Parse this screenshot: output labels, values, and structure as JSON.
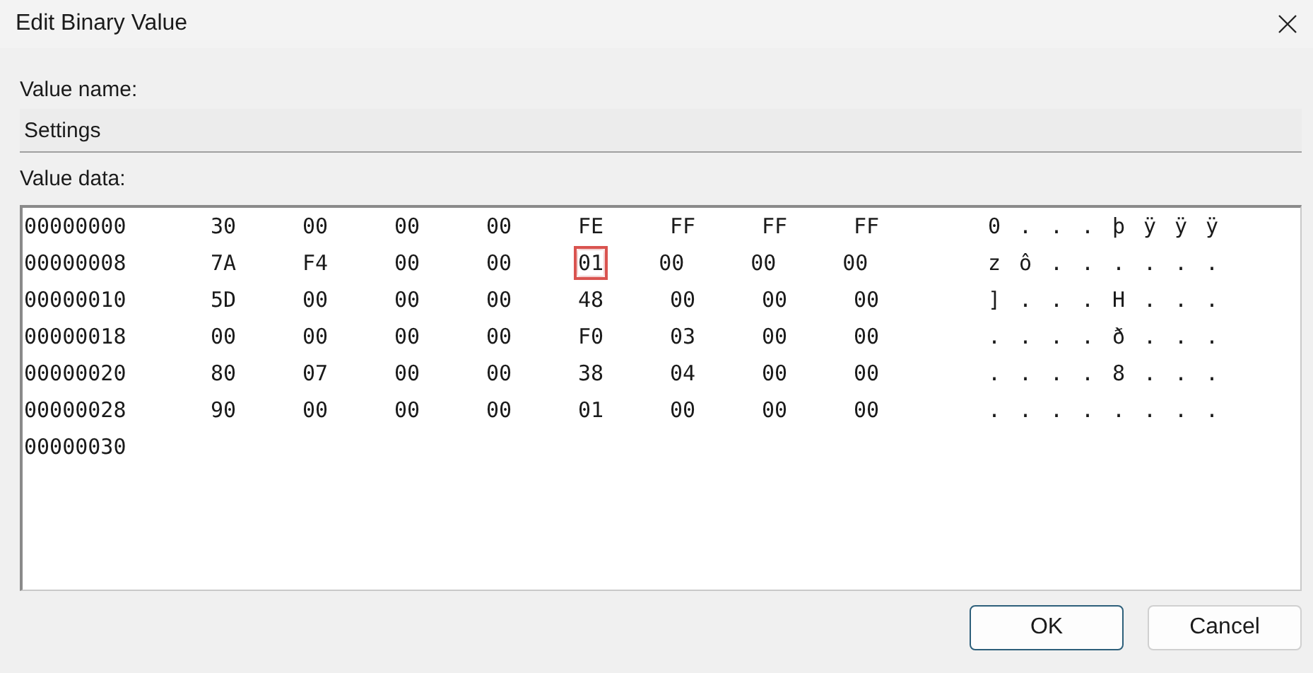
{
  "window": {
    "title": "Edit Binary Value"
  },
  "value_name": {
    "label": "Value name:",
    "value": "Settings"
  },
  "value_data": {
    "label": "Value data:",
    "rows": [
      {
        "address": "00000000",
        "bytes": [
          {
            "text": "30",
            "highlighted": false
          },
          {
            "text": "00",
            "highlighted": false
          },
          {
            "text": "00",
            "highlighted": false
          },
          {
            "text": "00",
            "highlighted": false
          },
          {
            "text": "FE",
            "highlighted": false
          },
          {
            "text": "FF",
            "highlighted": false
          },
          {
            "text": "FF",
            "highlighted": false
          },
          {
            "text": "FF",
            "highlighted": false
          }
        ],
        "ascii": [
          "0",
          ".",
          ".",
          ".",
          "þ",
          "ÿ",
          "ÿ",
          "ÿ"
        ]
      },
      {
        "address": "00000008",
        "bytes": [
          {
            "text": "7A",
            "highlighted": false
          },
          {
            "text": "F4",
            "highlighted": false
          },
          {
            "text": "00",
            "highlighted": false
          },
          {
            "text": "00",
            "highlighted": false
          },
          {
            "text": "01",
            "highlighted": true
          },
          {
            "text": "00",
            "highlighted": false
          },
          {
            "text": "00",
            "highlighted": false
          },
          {
            "text": "00",
            "highlighted": false
          }
        ],
        "ascii": [
          "z",
          "ô",
          ".",
          ".",
          ".",
          ".",
          ".",
          "."
        ]
      },
      {
        "address": "00000010",
        "bytes": [
          {
            "text": "5D",
            "highlighted": false
          },
          {
            "text": "00",
            "highlighted": false
          },
          {
            "text": "00",
            "highlighted": false
          },
          {
            "text": "00",
            "highlighted": false
          },
          {
            "text": "48",
            "highlighted": false
          },
          {
            "text": "00",
            "highlighted": false
          },
          {
            "text": "00",
            "highlighted": false
          },
          {
            "text": "00",
            "highlighted": false
          }
        ],
        "ascii": [
          "]",
          ".",
          ".",
          ".",
          "H",
          ".",
          ".",
          "."
        ]
      },
      {
        "address": "00000018",
        "bytes": [
          {
            "text": "00",
            "highlighted": false
          },
          {
            "text": "00",
            "highlighted": false
          },
          {
            "text": "00",
            "highlighted": false
          },
          {
            "text": "00",
            "highlighted": false
          },
          {
            "text": "F0",
            "highlighted": false
          },
          {
            "text": "03",
            "highlighted": false
          },
          {
            "text": "00",
            "highlighted": false
          },
          {
            "text": "00",
            "highlighted": false
          }
        ],
        "ascii": [
          ".",
          ".",
          ".",
          ".",
          "ð",
          ".",
          ".",
          "."
        ]
      },
      {
        "address": "00000020",
        "bytes": [
          {
            "text": "80",
            "highlighted": false
          },
          {
            "text": "07",
            "highlighted": false
          },
          {
            "text": "00",
            "highlighted": false
          },
          {
            "text": "00",
            "highlighted": false
          },
          {
            "text": "38",
            "highlighted": false
          },
          {
            "text": "04",
            "highlighted": false
          },
          {
            "text": "00",
            "highlighted": false
          },
          {
            "text": "00",
            "highlighted": false
          }
        ],
        "ascii": [
          ".",
          ".",
          ".",
          ".",
          "8",
          ".",
          ".",
          "."
        ]
      },
      {
        "address": "00000028",
        "bytes": [
          {
            "text": "90",
            "highlighted": false
          },
          {
            "text": "00",
            "highlighted": false
          },
          {
            "text": "00",
            "highlighted": false
          },
          {
            "text": "00",
            "highlighted": false
          },
          {
            "text": "01",
            "highlighted": false
          },
          {
            "text": "00",
            "highlighted": false
          },
          {
            "text": "00",
            "highlighted": false
          },
          {
            "text": "00",
            "highlighted": false
          }
        ],
        "ascii": [
          ".",
          ".",
          ".",
          ".",
          ".",
          ".",
          ".",
          "."
        ]
      },
      {
        "address": "00000030",
        "bytes": [],
        "ascii": []
      }
    ]
  },
  "buttons": [
    {
      "label": "OK",
      "kind": "default"
    },
    {
      "label": "Cancel",
      "kind": "normal"
    }
  ]
}
